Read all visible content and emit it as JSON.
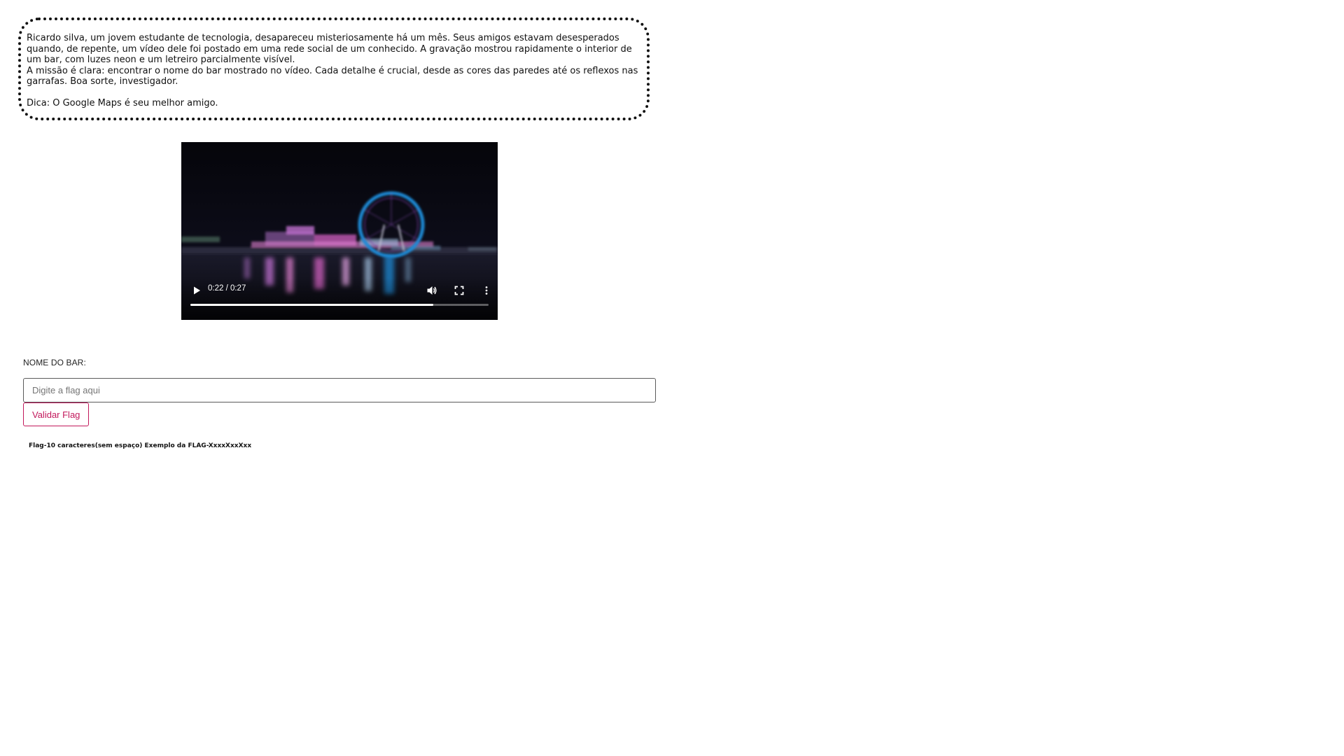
{
  "story": {
    "paragraph1": "Ricardo silva, um jovem estudante de tecnologia, desapareceu misteriosamente há um mês. Seus amigos estavam desesperados quando, de repente, um vídeo dele foi postado em uma rede social de um conhecido. A gravação mostrou rapidamente o interior de um bar, com luzes neon e um letreiro parcialmente visível.",
    "paragraph2": "A missão é clara: encontrar o nome do bar mostrado no vídeo. Cada detalhe é crucial, desde as cores das paredes até os reflexos nas garrafas. Boa sorte, investigador.",
    "hint": "Dica: O Google Maps é seu melhor amigo."
  },
  "video": {
    "time_display": "0:22 / 0:27",
    "current_seconds": 22,
    "duration_seconds": 27,
    "icons": {
      "play": "play-icon",
      "volume": "volume-icon",
      "fullscreen": "fullscreen-icon",
      "more": "more-vertical-icon"
    }
  },
  "form": {
    "label": "NOME DO BAR:",
    "placeholder": "Digite a flag aqui",
    "value": "",
    "button_label": "Validar Flag",
    "note": "Flag-10 caracteres(sem espaço) Exemplo da FLAG-XxxxXxxXxx"
  },
  "colors": {
    "accent": "#c2185b",
    "text": "#111111",
    "input_border": "#5a5a5a",
    "video_background": "#0a0a14",
    "ferris_wheel": "#1e8ad6"
  }
}
